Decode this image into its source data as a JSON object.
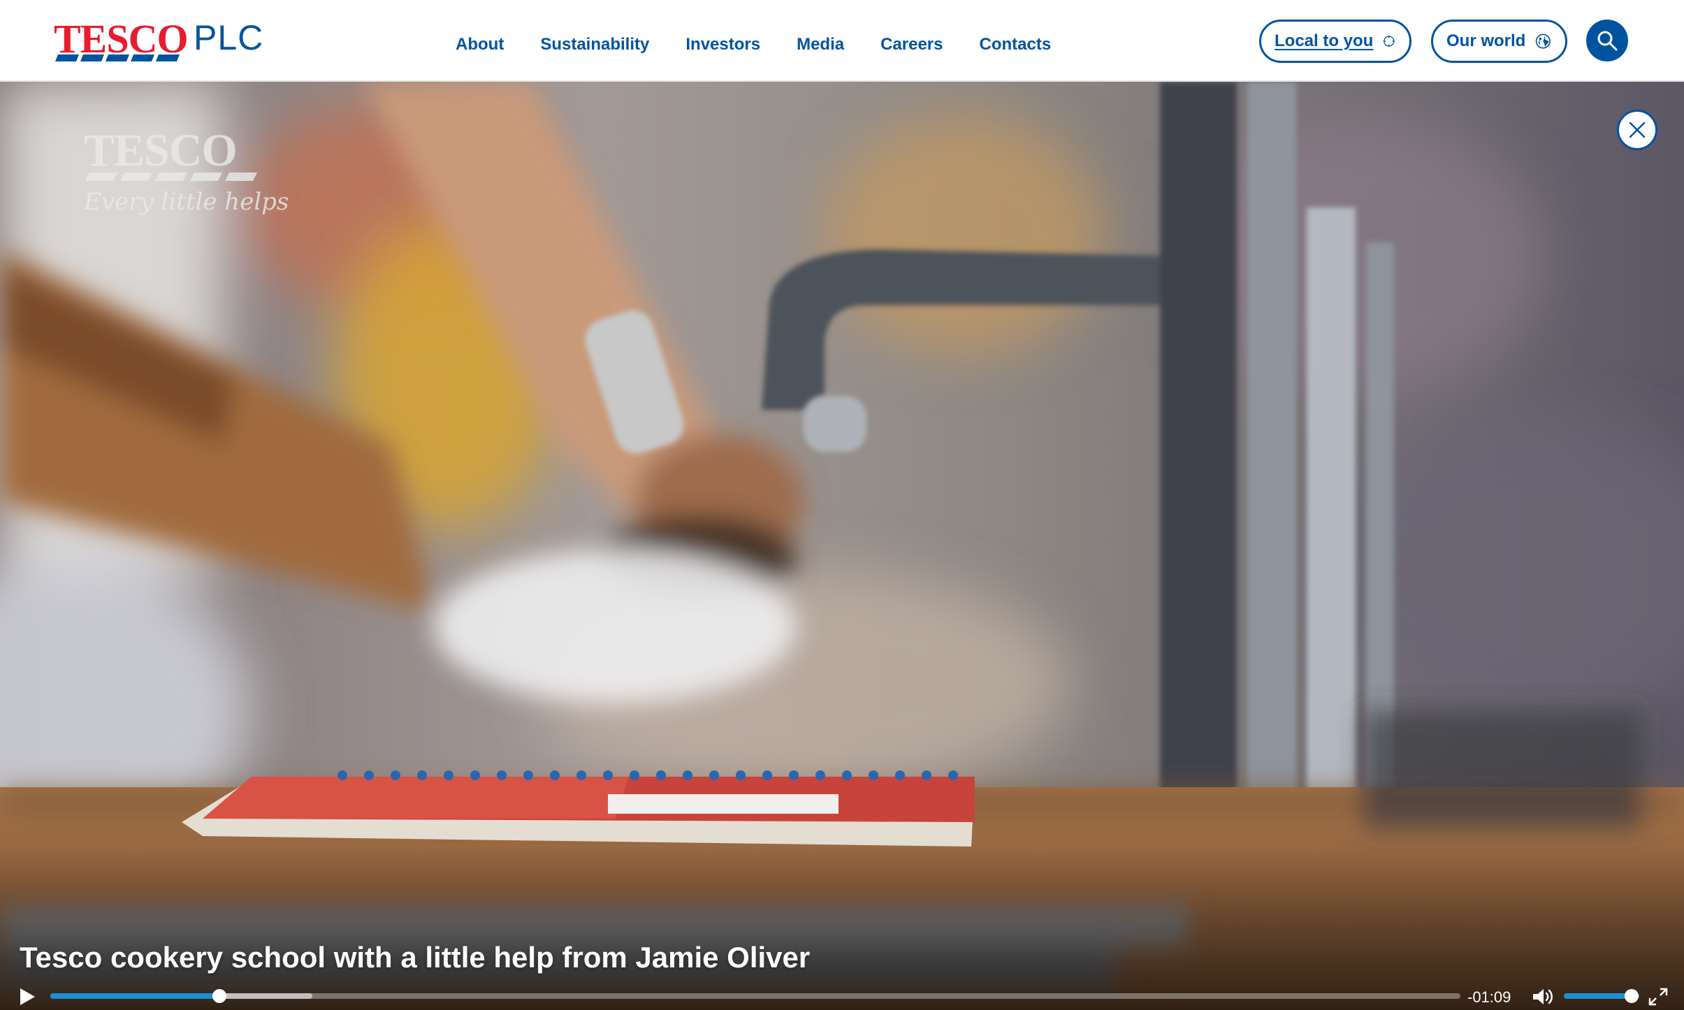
{
  "brand": {
    "logo_text": "TESCO",
    "suffix": "PLC",
    "logo_color": "#e81c2e",
    "primary_color": "#00539f"
  },
  "nav": {
    "items": [
      {
        "label": "About"
      },
      {
        "label": "Sustainability"
      },
      {
        "label": "Investors"
      },
      {
        "label": "Media"
      },
      {
        "label": "Careers"
      },
      {
        "label": "Contacts"
      }
    ]
  },
  "header_actions": {
    "local_label": "Local to you",
    "local_icon": "crosshair-icon",
    "world_label": "Our world",
    "world_icon": "globe-icon",
    "search_icon": "search-icon"
  },
  "video": {
    "watermark_word": "TESCO",
    "watermark_tagline": "Every little helps",
    "title": "Tesco cookery school with a little help from Jamie Oliver",
    "close_icon": "close-icon",
    "play_icon": "play-icon",
    "time_remaining": "-01:09",
    "progress": 0.12,
    "buffered": 0.186,
    "volume": 0.9,
    "accent_color": "#1a8fd6",
    "volume_icon": "volume-icon",
    "fullscreen_icon": "fullscreen-icon"
  }
}
